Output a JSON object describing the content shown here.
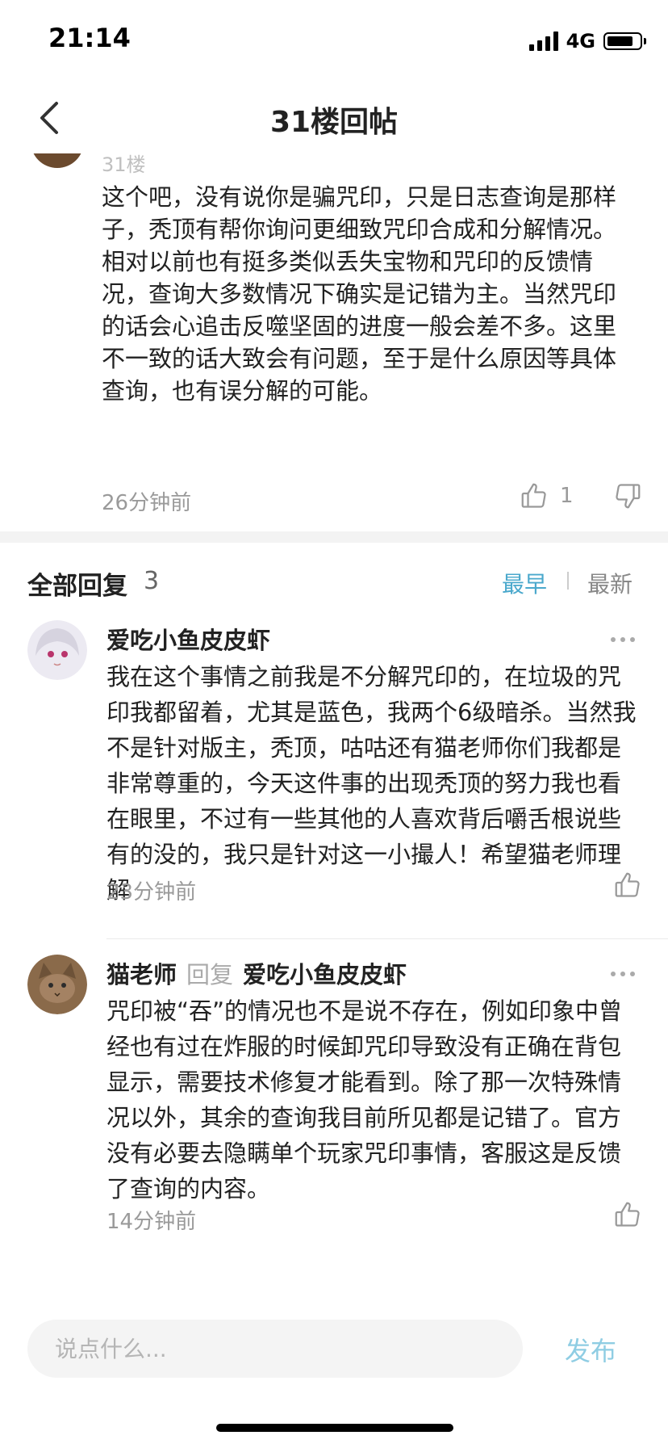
{
  "status_bar": {
    "time": "21:14",
    "network": "4G",
    "battery_level": 0.7
  },
  "nav": {
    "title": "31楼回帖"
  },
  "main_post": {
    "floor": "31楼",
    "body": "这个吧，没有说你是骗咒印，只是日志查询是那样子，秃顶有帮你询问更细致咒印合成和分解情况。\n相对以前也有挺多类似丢失宝物和咒印的反馈情况，查询大多数情况下确实是记错为主。当然咒印的话会心追击反噬坚固的进度一般会差不多。这里不一致的话大致会有问题，至于是什么原因等具体查询，也有误分解的可能。",
    "time": "26分钟前",
    "like_count": "1"
  },
  "replies_header": {
    "label": "全部回复",
    "count": "3",
    "sort_earliest": "最早",
    "sort_latest": "最新",
    "active_color": "#4aa8cc"
  },
  "replies": [
    {
      "author": "爱吃小鱼皮皮虾",
      "body": "我在这个事情之前我是不分解咒印的，在垃圾的咒印我都留着，尤其是蓝色，我两个6级暗杀。当然我不是针对版主，秃顶，咕咕还有猫老师你们我都是非常尊重的，今天这件事的出现秃顶的努力我也看在眼里，不过有一些其他的人喜欢背后嚼舌根说些有的没的，我只是针对这一小撮人！希望猫老师理解",
      "time": "23分钟前"
    },
    {
      "author": "猫老师",
      "verb": "回复",
      "target": "爱吃小鱼皮皮虾",
      "body": "咒印被“吞”的情况也不是说不存在，例如印象中曾经也有过在炸服的时候卸咒印导致没有正确在背包显示，需要技术修复才能看到。除了那一次特殊情况以外，其余的查询我目前所见都是记错了。官方没有必要去隐瞒单个玩家咒印事情，客服这是反馈了查询的内容。",
      "time": "14分钟前"
    }
  ],
  "composer": {
    "placeholder": "说点什么...",
    "publish_label": "发布",
    "publish_color": "#8fcde3"
  }
}
